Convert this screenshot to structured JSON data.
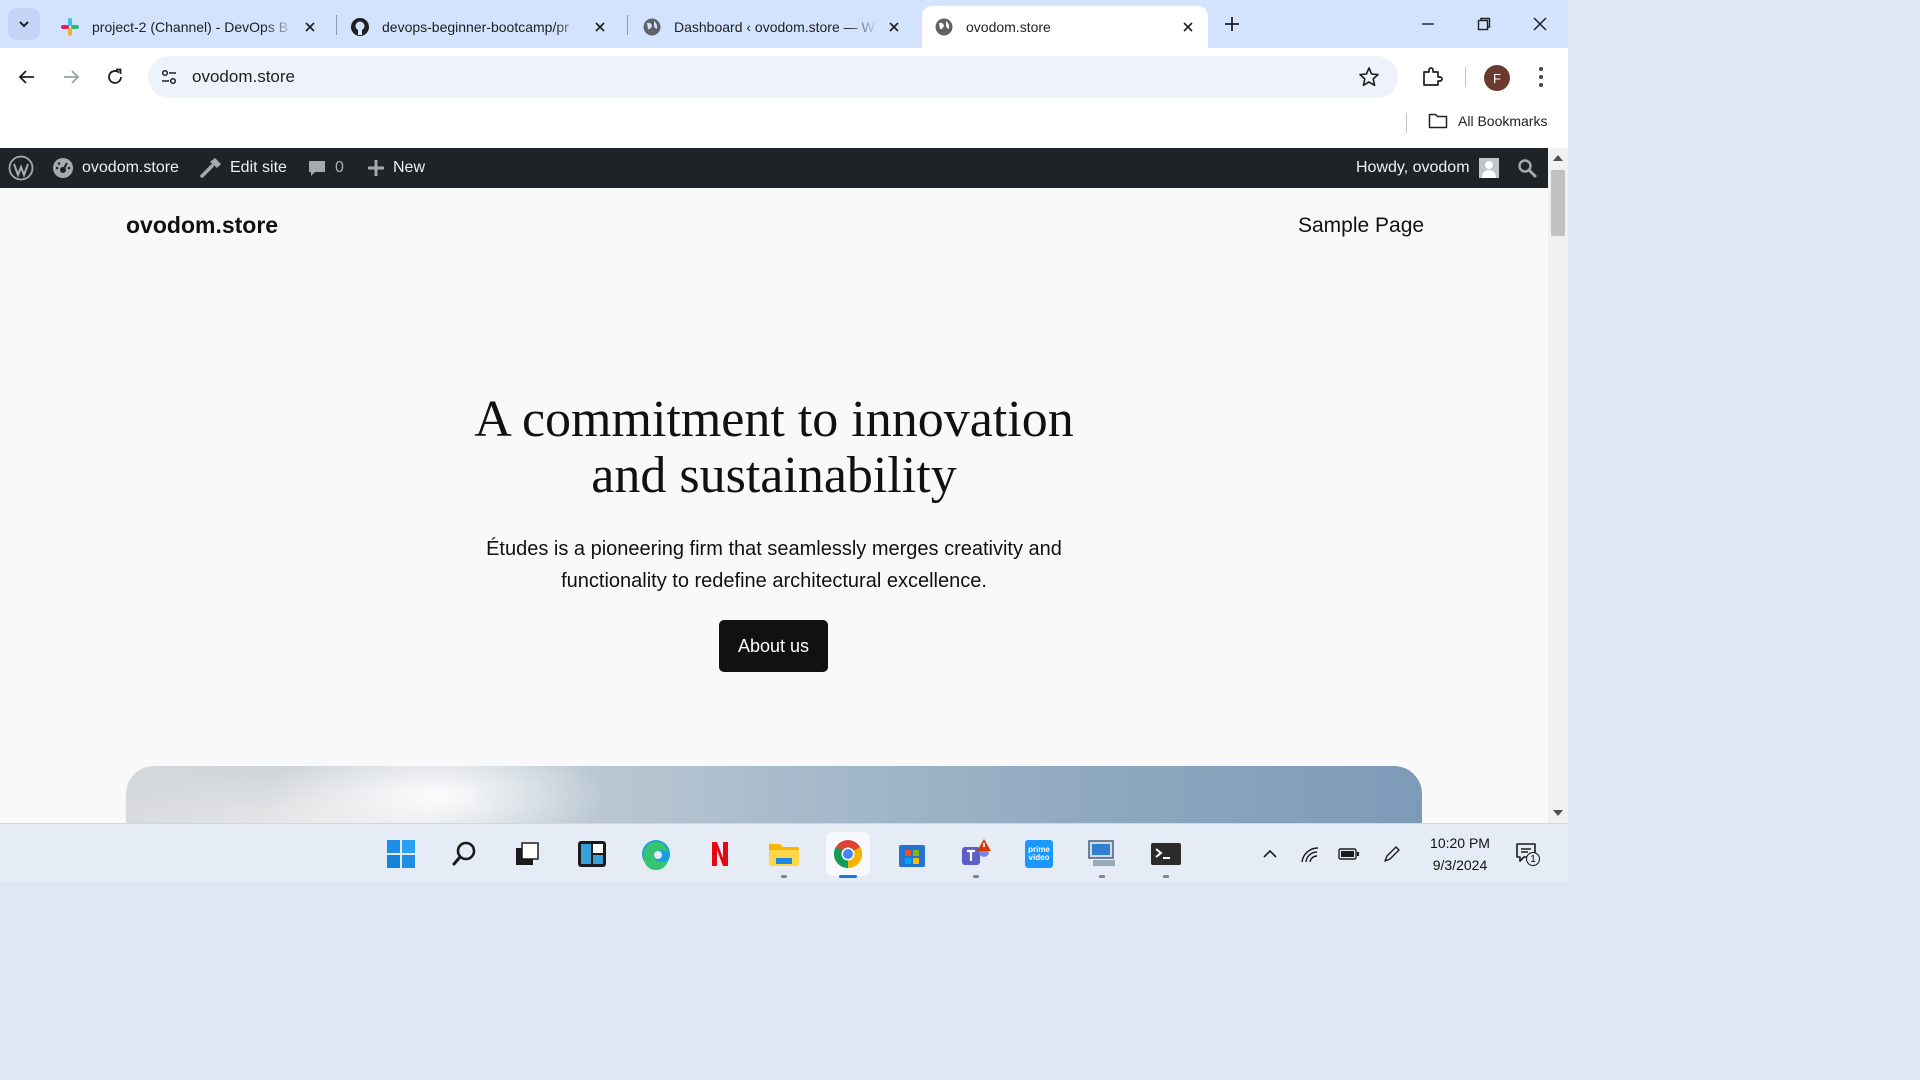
{
  "browser": {
    "tabs": [
      {
        "title": "project-2 (Channel) - DevOps B",
        "icon": "slack-icon",
        "active": false
      },
      {
        "title": "devops-beginner-bootcamp/pr",
        "icon": "github-icon",
        "active": false
      },
      {
        "title": "Dashboard ‹ ovodom.store — W",
        "icon": "globe-icon",
        "active": false
      },
      {
        "title": "ovodom.store",
        "icon": "globe-icon",
        "active": true
      }
    ],
    "url": "ovodom.store",
    "profile_initial": "F",
    "bookmarks_label": "All Bookmarks"
  },
  "admin_bar": {
    "site_name": "ovodom.store",
    "edit_site": "Edit site",
    "comments_count": "0",
    "new_label": "New",
    "howdy": "Howdy, ovodom"
  },
  "site": {
    "title": "ovodom.store",
    "nav": [
      "Sample Page"
    ]
  },
  "hero": {
    "heading_line1": "A commitment to innovation",
    "heading_line2": "and sustainability",
    "text_line1": "Études is a pioneering firm that seamlessly merges creativity and",
    "text_line2": "functionality to redefine architectural excellence.",
    "button": "About us"
  },
  "taskbar": {
    "apps": [
      "windows-start-icon",
      "search-icon",
      "task-view-icon",
      "widgets-icon",
      "edge-icon",
      "netflix-icon",
      "file-explorer-icon",
      "chrome-icon",
      "store-icon",
      "teams-icon",
      "prime-video-icon",
      "remote-desktop-icon",
      "terminal-icon"
    ],
    "time": "10:20 PM",
    "date": "9/3/2024",
    "notification_count": "1"
  },
  "colors": {
    "tabstrip": "#d3e3fd",
    "admin_bar": "#1d2327",
    "page_bg": "#f9f9f9",
    "button_bg": "#111111"
  }
}
